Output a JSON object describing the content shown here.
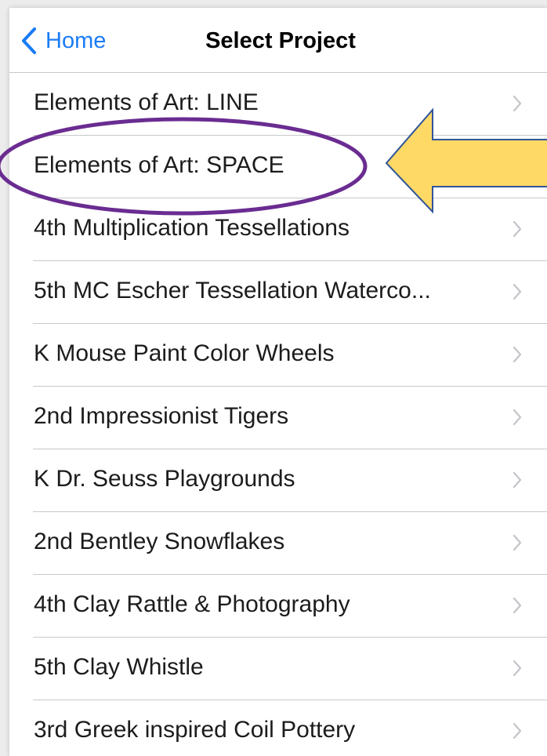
{
  "nav": {
    "back_label": "Home",
    "title": "Select Project"
  },
  "projects": [
    {
      "label": "Elements of Art: LINE"
    },
    {
      "label": "Elements of Art: SPACE"
    },
    {
      "label": "4th Multiplication Tessellations"
    },
    {
      "label": "5th MC Escher Tessellation Waterco..."
    },
    {
      "label": "K Mouse Paint Color Wheels"
    },
    {
      "label": "2nd Impressionist Tigers"
    },
    {
      "label": "K Dr. Seuss Playgrounds"
    },
    {
      "label": "2nd Bentley Snowflakes"
    },
    {
      "label": "4th Clay Rattle & Photography"
    },
    {
      "label": "5th Clay Whistle"
    },
    {
      "label": "3rd Greek inspired Coil Pottery"
    }
  ],
  "icons": {
    "back": "chevron-left-icon",
    "row_disclosure": "chevron-right-icon"
  },
  "colors": {
    "accent": "#1a7cf5",
    "highlight_oval": "#6a2c91",
    "arrow_fill": "#ffd966",
    "arrow_stroke": "#2f5597"
  }
}
